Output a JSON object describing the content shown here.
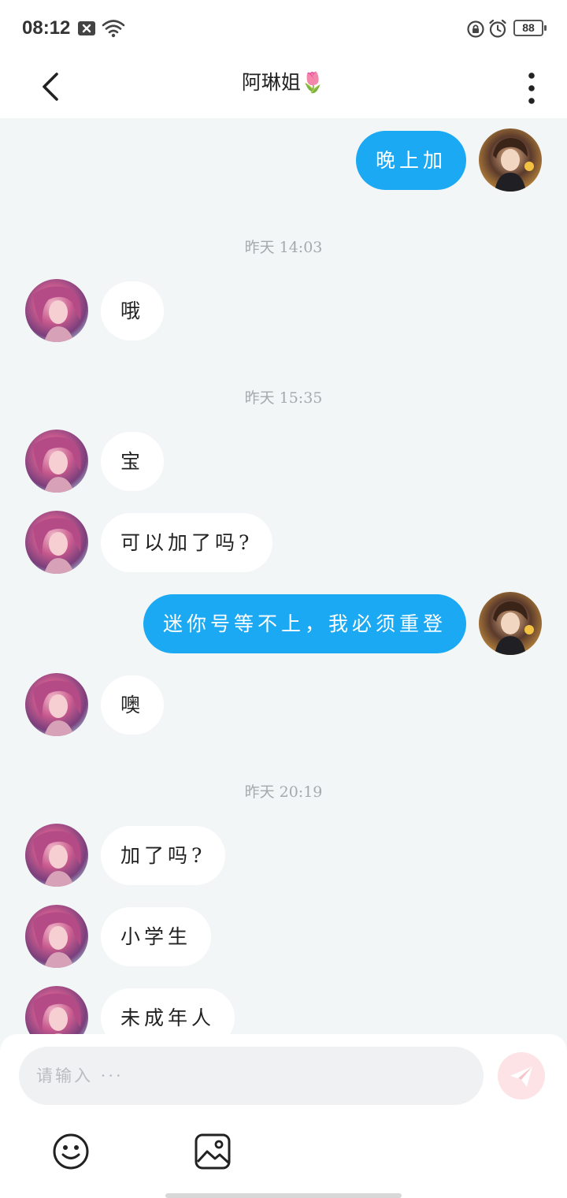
{
  "status_bar": {
    "time": "08:12",
    "battery": "88",
    "icons": [
      "close-box-icon",
      "wifi-icon",
      "rotation-lock-icon",
      "alarm-icon",
      "battery-icon"
    ]
  },
  "header": {
    "title": "阿琳姐🌷",
    "back_icon": "chevron-left-icon",
    "more_icon": "more-vertical-icon"
  },
  "messages": [
    {
      "dir": "out",
      "text": "晚上加"
    },
    {
      "time": "昨天 14:03"
    },
    {
      "dir": "in",
      "text": "哦"
    },
    {
      "time": "昨天 15:35"
    },
    {
      "dir": "in",
      "text": "宝"
    },
    {
      "dir": "in",
      "text": "可以加了吗?"
    },
    {
      "dir": "out",
      "text": "迷你号等不上，我必须重登"
    },
    {
      "dir": "in",
      "text": "噢"
    },
    {
      "time": "昨天 20:19"
    },
    {
      "dir": "in",
      "text": "加了吗?"
    },
    {
      "dir": "in",
      "text": "小学生"
    },
    {
      "dir": "in",
      "text": "未成年人"
    }
  ],
  "composer": {
    "placeholder": "请输入 ···",
    "send_icon": "paper-plane-icon",
    "emoji_icon": "smiley-icon",
    "image_icon": "image-icon"
  },
  "colors": {
    "accent": "#1aa9f2",
    "background": "#f3f6f7",
    "send_disabled": "#fde3e5"
  }
}
